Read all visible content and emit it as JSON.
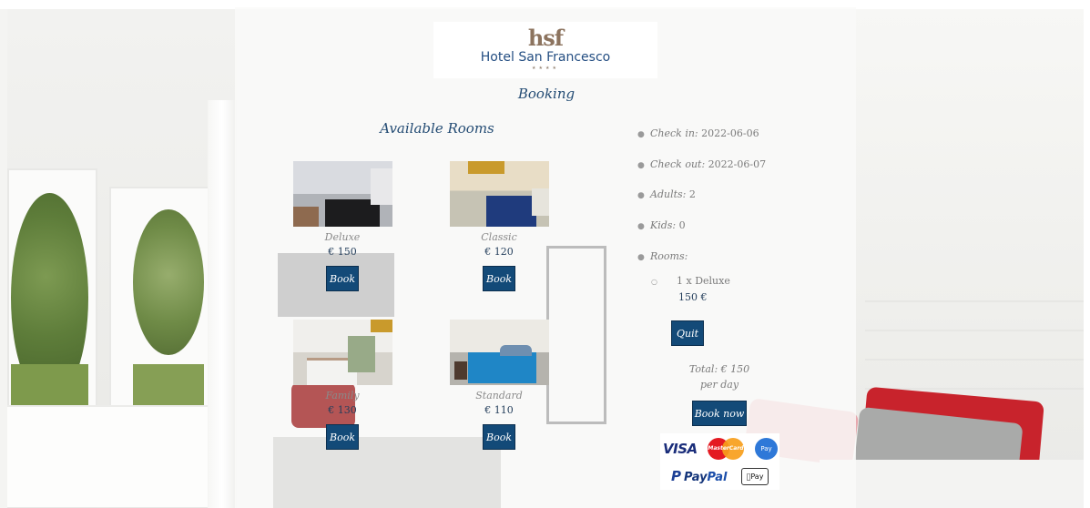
{
  "hotel": {
    "logo_mark": "hsf",
    "logo_name": "Hotel San Francesco",
    "logo_stars": "★★★★"
  },
  "page": {
    "title": "Booking",
    "rooms_title": "Available Rooms"
  },
  "rooms": [
    {
      "name": "Deluxe",
      "price": "€ 150",
      "button": "Book"
    },
    {
      "name": "Classic",
      "price": "€ 120",
      "button": "Book"
    },
    {
      "name": "Family",
      "price": "€ 130",
      "button": "Book"
    },
    {
      "name": "Standard",
      "price": "€ 110",
      "button": "Book"
    }
  ],
  "summary": {
    "check_in_label": "Check in:",
    "check_in_value": "2022-06-06",
    "check_out_label": "Check out:",
    "check_out_value": "2022-06-07",
    "adults_label": "Adults:",
    "adults_value": "2",
    "kids_label": "Kids:",
    "kids_value": "0",
    "rooms_label": "Rooms:",
    "selected_room": "1 x Deluxe",
    "selected_room_price": "150 €",
    "quit_button": "Quit",
    "total_line1": "Total: € 150",
    "total_line2": "per day",
    "book_now_button": "Book now"
  },
  "payment": {
    "visa": "VISA",
    "mastercard": "MasterCard",
    "gpay": "Pay",
    "paypal_icon": "P",
    "paypal_pay": "Pay",
    "paypal_pal": "Pal",
    "applepay": "Pay"
  },
  "colors": {
    "accent": "#134a78",
    "heading": "#244c74"
  }
}
